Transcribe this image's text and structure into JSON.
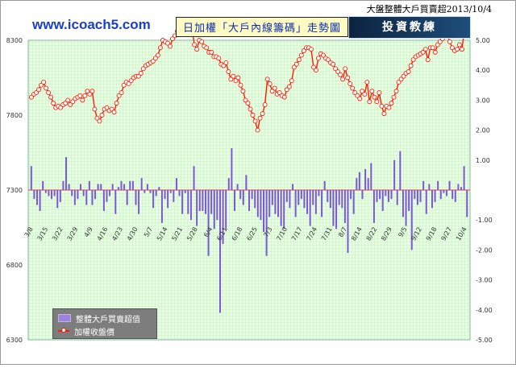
{
  "header": {
    "top_title": "大盤整體大戶買賣超2013/10/4",
    "brand": "www.icoach5.com",
    "chart_title": "日加權「大戶內線籌碼」走勢圖",
    "logo_text": "投資教練"
  },
  "legend": {
    "bar_label": "整體大戶買賣超值",
    "line_label": "加權收盤價"
  },
  "chart_data": {
    "type": "bar+line",
    "x_tick_labels": [
      "3/8",
      "3/15",
      "3/22",
      "3/29",
      "4/9",
      "4/16",
      "4/23",
      "4/30",
      "5/7",
      "5/14",
      "5/21",
      "5/28",
      "6/4",
      "6/11",
      "6/18",
      "6/25",
      "7/3",
      "7/10",
      "7/17",
      "7/24",
      "7/31",
      "8/7",
      "8/14",
      "8/22",
      "8/29",
      "9/5",
      "9/12",
      "9/18",
      "9/27",
      "10/4"
    ],
    "y_left": {
      "ticks": [
        6300,
        6800,
        7300,
        7800,
        8300
      ],
      "range": [
        6300,
        8300
      ]
    },
    "y_right": {
      "ticks": [
        "-5.00",
        "-4.00",
        "-3.00",
        "-2.00",
        "-1.00",
        "1.00",
        "2.00",
        "3.00",
        "4.00",
        "5.00"
      ],
      "range": [
        -5,
        5
      ]
    },
    "series": [
      {
        "name": "整體大戶買賣超值",
        "type": "bar",
        "values": [
          0.8,
          -0.3,
          -0.5,
          -0.7,
          0.3,
          -0.1,
          -0.2,
          -0.3,
          -0.2,
          -0.6,
          -0.4,
          0.3,
          1.1,
          0.2,
          -0.2,
          -0.5,
          -0.3,
          0.2,
          -0.2,
          -0.5,
          0.3,
          -0.5,
          -0.3,
          0.2,
          0.2,
          -0.7,
          -0.4,
          -0.2,
          0.2,
          -0.8,
          0.1,
          0.3,
          0.2,
          -0.5,
          0.3,
          0.3,
          -0.5,
          -0.8,
          0.4,
          -0.1,
          0.2,
          -0.1,
          -0.6,
          -0.2,
          0.1,
          -1.1,
          -0.3,
          -0.6,
          -0.1,
          -0.4,
          0.4,
          -0.2,
          -0.8,
          -0.1,
          -0.8,
          -1.0,
          0.8,
          -1.2,
          -0.7,
          -0.7,
          -0.8,
          -2.2,
          -0.8,
          -1.3,
          -1.0,
          -4.1,
          -1.8,
          -1.3,
          0.4,
          1.4,
          -0.7,
          0.2,
          -0.3,
          -0.5,
          0.5,
          -0.7,
          -0.3,
          -0.6,
          -0.9,
          -1.0,
          -1.4,
          -2.2,
          -0.9,
          -0.5,
          -0.8,
          -0.9,
          -1.2,
          -1.3,
          -0.4,
          -0.6,
          0.2,
          -0.9,
          -0.5,
          -0.3,
          -0.6,
          -0.8,
          -1.2,
          -0.5,
          -0.8,
          -0.2,
          -0.9,
          0.3,
          -0.4,
          -0.6,
          -1.2,
          -1.3,
          -0.5,
          -0.6,
          -1.1,
          -2.1,
          -0.3,
          -0.8,
          0.4,
          0.6,
          -0.3,
          0.7,
          0.4,
          0.9,
          -1.1,
          -0.4,
          -0.3,
          -0.7,
          -0.2,
          -0.4,
          -0.3,
          1.0,
          -0.5,
          1.3,
          -0.9,
          -1.2,
          -0.7,
          -2.0,
          -0.3,
          -0.5,
          -0.4,
          0.3,
          -0.8,
          0.2,
          -0.6,
          -0.4,
          0.3,
          -0.3,
          -0.1,
          -0.2,
          0.3,
          -0.3,
          -0.4,
          0.2,
          0.1,
          0.8,
          -0.9
        ]
      },
      {
        "name": "加權收盤價",
        "type": "line",
        "values": [
          7920,
          7940,
          7950,
          7970,
          8000,
          8020,
          7980,
          7950,
          7920,
          7880,
          7850,
          7860,
          7850,
          7870,
          7880,
          7900,
          7870,
          7890,
          7910,
          7920,
          7930,
          7900,
          7930,
          7960,
          7940,
          7960,
          7840,
          7780,
          7760,
          7800,
          7840,
          7850,
          7830,
          7840,
          7820,
          7880,
          7930,
          7950,
          8000,
          8020,
          8010,
          8030,
          8050,
          8060,
          8060,
          8080,
          8110,
          8130,
          8140,
          8150,
          8160,
          8180,
          8200,
          8250,
          8300,
          8290,
          8280,
          8260,
          8310,
          8330,
          8360,
          8340,
          8350,
          8370,
          8380,
          8370,
          8380,
          8270,
          8240,
          8300,
          8290,
          8260,
          8250,
          8220,
          8220,
          8190,
          8190,
          8180,
          8140,
          8130,
          8150,
          8090,
          8040,
          8060,
          8030,
          8050,
          8000,
          7960,
          7900,
          7880,
          7840,
          7800,
          7760,
          7700,
          7780,
          7810,
          7870,
          8040,
          8010,
          7960,
          7980,
          7940,
          7950,
          7930,
          7920,
          7970,
          7990,
          8030,
          8120,
          8140,
          8170,
          8200,
          8230,
          8250,
          8250,
          8240,
          8120,
          8100,
          8180,
          8210,
          8200,
          8180,
          8170,
          8150,
          8140,
          8110,
          8090,
          8070,
          8040,
          8110,
          8050,
          8010,
          7980,
          7950,
          7930,
          7910,
          7960,
          7940,
          8020,
          7890,
          7960,
          7920,
          7890,
          7950,
          7860,
          7810,
          7860,
          7850,
          7880,
          7920,
          7960,
          8020,
          8040,
          8060,
          8080,
          8090,
          8130,
          8170,
          8190,
          8200,
          8210,
          8220,
          8240,
          8170,
          8250,
          8250,
          8220,
          8270,
          8290,
          8310,
          8330,
          8330,
          8290,
          8250,
          8230,
          8240,
          8270,
          8240,
          8370,
          8380
        ]
      }
    ],
    "grid": true,
    "legend_position": "bottom-left"
  }
}
